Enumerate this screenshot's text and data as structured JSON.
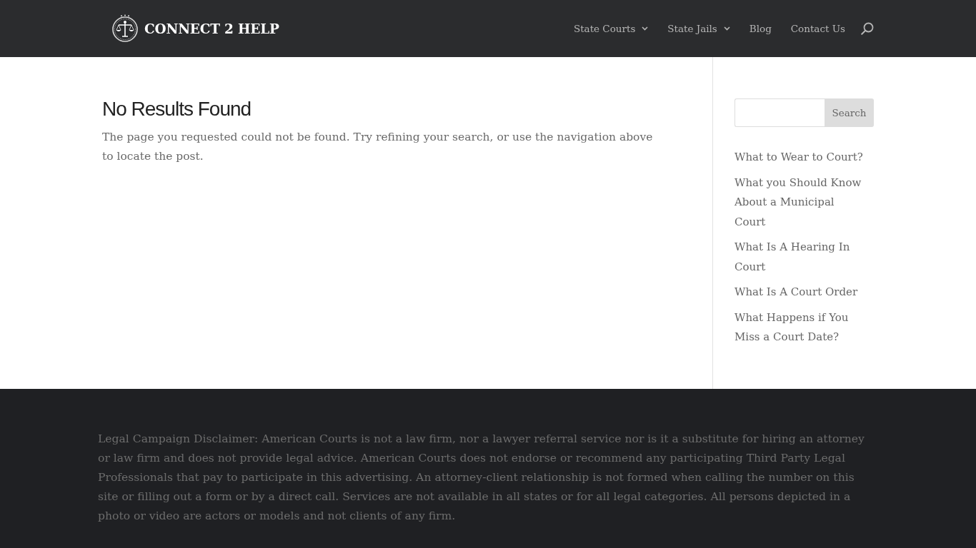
{
  "header": {
    "logo_text": "CONNECT 2 HELP",
    "nav": [
      {
        "label": "State Courts",
        "has_dropdown": true
      },
      {
        "label": "State Jails",
        "has_dropdown": true
      },
      {
        "label": "Blog",
        "has_dropdown": false
      },
      {
        "label": "Contact Us",
        "has_dropdown": false
      }
    ]
  },
  "main": {
    "title": "No Results Found",
    "message": "The page you requested could not be found. Try refining your search, or use the navigation above to locate the post."
  },
  "sidebar": {
    "search": {
      "button": "Search"
    },
    "links": [
      "What to Wear to Court?",
      "What you Should Know About a Municipal Court",
      "What Is A Hearing In Court",
      "What Is A Court Order",
      "What Happens if You Miss a Court Date?"
    ]
  },
  "footer": {
    "disclaimer": "Legal Campaign Disclaimer: American Courts is not a law firm, nor a lawyer referral service nor is it a substitute for hiring an attorney or law firm and does not provide legal advice. American Courts does not endorse or recommend any participating Third Party Legal Professionals that pay to participate in this advertising. An attorney-client relationship is not formed when calling the number on this site or filling out a form or by a direct call. Services are not available in all states or for all legal categories. All persons depicted in a photo or video are actors or models and not clients of any firm."
  }
}
